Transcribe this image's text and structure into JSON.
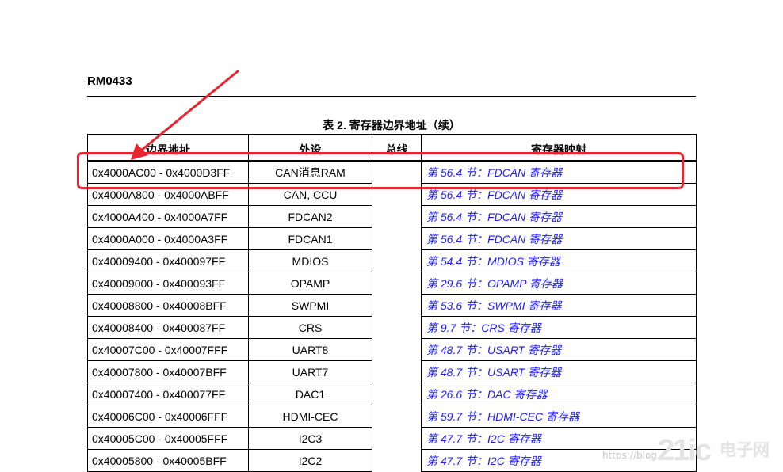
{
  "header": {
    "doc_id": "RM0433"
  },
  "table": {
    "caption": "表 2. 寄存器边界地址（续）",
    "columns": [
      "边界地址",
      "外设",
      "总线",
      "寄存器映射"
    ],
    "rows": [
      {
        "addr": "0x4000AC00 - 0x4000D3FF",
        "periph": "CAN消息RAM",
        "map": "第 56.4 节：FDCAN 寄存器"
      },
      {
        "addr": "0x4000A800 - 0x4000ABFF",
        "periph": "CAN, CCU",
        "map": "第 56.4 节：FDCAN 寄存器"
      },
      {
        "addr": "0x4000A400 - 0x4000A7FF",
        "periph": "FDCAN2",
        "map": "第 56.4 节：FDCAN 寄存器"
      },
      {
        "addr": "0x4000A000 - 0x4000A3FF",
        "periph": "FDCAN1",
        "map": "第 56.4 节：FDCAN 寄存器"
      },
      {
        "addr": "0x40009400 - 0x400097FF",
        "periph": "MDIOS",
        "map": "第 54.4 节：MDIOS 寄存器"
      },
      {
        "addr": "0x40009000 - 0x400093FF",
        "periph": "OPAMP",
        "map": "第 29.6 节：OPAMP 寄存器"
      },
      {
        "addr": "0x40008800 - 0x40008BFF",
        "periph": "SWPMI",
        "map": "第 53.6 节：SWPMI 寄存器"
      },
      {
        "addr": "0x40008400 - 0x400087FF",
        "periph": "CRS",
        "map": "第 9.7 节：CRS 寄存器"
      },
      {
        "addr": "0x40007C00 - 0x40007FFF",
        "periph": "UART8",
        "map": "第 48.7 节：USART 寄存器"
      },
      {
        "addr": "0x40007800 - 0x40007BFF",
        "periph": "UART7",
        "map": "第 48.7 节：USART 寄存器"
      },
      {
        "addr": "0x40007400 - 0x400077FF",
        "periph": "DAC1",
        "map": "第 26.6 节：DAC 寄存器"
      },
      {
        "addr": "0x40006C00 - 0x40006FFF",
        "periph": "HDMI-CEC",
        "map": "第 59.7 节：HDMI-CEC 寄存器"
      },
      {
        "addr": "0x40005C00 - 0x40005FFF",
        "periph": "I2C3",
        "map": "第 47.7 节：I2C 寄存器"
      },
      {
        "addr": "0x40005800 - 0x40005BFF",
        "periph": "I2C2",
        "map": "第 47.7 节：I2C 寄存器"
      }
    ]
  },
  "watermark": {
    "url": "https://blog.",
    "logo": "21ic",
    "cn": "电子网"
  },
  "colors": {
    "link": "#1a1aff",
    "highlight": "#e8242e"
  }
}
